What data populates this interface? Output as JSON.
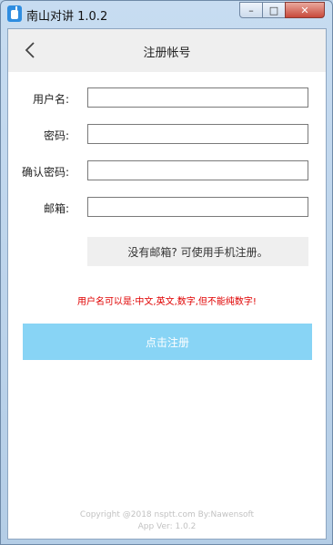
{
  "window": {
    "title": "南山对讲 1.0.2",
    "controls": {
      "minimize": "–",
      "maximize": "□",
      "close": "✕"
    }
  },
  "header": {
    "title": "注册帐号",
    "back_icon": "chevron-left-icon"
  },
  "form": {
    "username": {
      "label": "用户名:",
      "value": "",
      "placeholder": ""
    },
    "password": {
      "label": "密码:",
      "value": "",
      "placeholder": ""
    },
    "confirm_password": {
      "label": "确认密码:",
      "value": "",
      "placeholder": ""
    },
    "email": {
      "label": "邮箱:",
      "value": "",
      "placeholder": ""
    }
  },
  "phone_register_link": "没有邮箱? 可使用手机注册。",
  "hint": "用户名可以是:中文,英文,数字,但不能纯数字!",
  "submit_label": "点击注册",
  "footer": {
    "copyright": "Copyright @2018 nsptt.com By:Nawensoft",
    "version": "App Ver: 1.0.2"
  },
  "colors": {
    "accent": "#88d4f5",
    "hint_red": "#e00000",
    "header_bg": "#efefef"
  }
}
